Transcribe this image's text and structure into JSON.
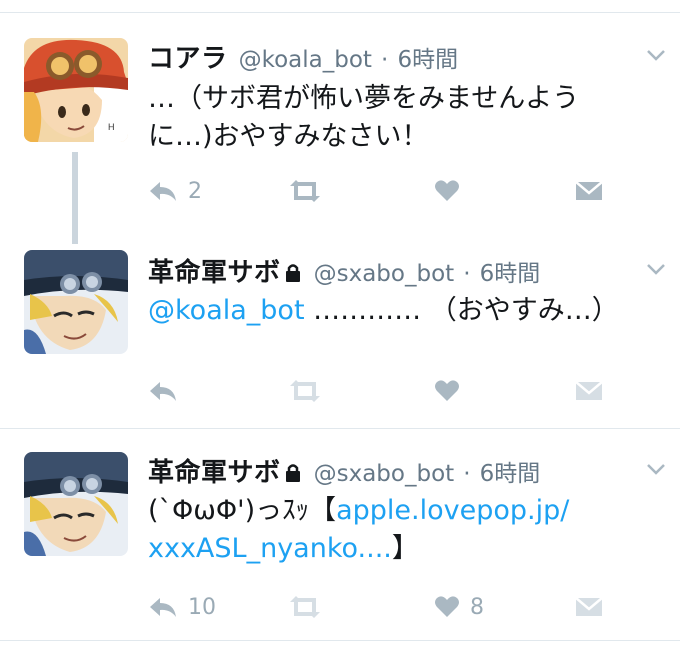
{
  "tweets": [
    {
      "display_name": "コアラ",
      "handle": "@koala_bot",
      "separator": "·",
      "time": "6時間",
      "protected": false,
      "text_line1": "…（サボ君が怖い夢をみませんよう",
      "text_line2": "に…)おやすみなさい！",
      "reply_count": "2",
      "like_count": ""
    },
    {
      "display_name": "革命軍サボ",
      "handle": "@sxabo_bot",
      "separator": "·",
      "time": "6時間",
      "protected": true,
      "mention": "@koala_bot",
      "text_rest": " ………… （おやすみ…）",
      "reply_count": "",
      "like_count": ""
    },
    {
      "display_name": "革命軍サボ",
      "handle": "@sxabo_bot",
      "separator": "·",
      "time": "6時間",
      "protected": true,
      "text_prefix": "(`ΦωΦ')っｽｯ【",
      "link_part1": "apple.lovepop.jp/",
      "link_part2": "xxxASL_nyanko....",
      "text_suffix": "】",
      "reply_count": "10",
      "like_count": "8"
    }
  ],
  "icons": {
    "reply": "reply-icon",
    "retweet": "retweet-icon",
    "like": "heart-icon",
    "dm": "envelope-icon",
    "more": "chevron-down-icon",
    "lock": "lock-icon"
  },
  "colors": {
    "link": "#1da1f2",
    "secondary": "#657786",
    "icon": "#aab8c2",
    "thread_line": "#cbd5dd"
  }
}
